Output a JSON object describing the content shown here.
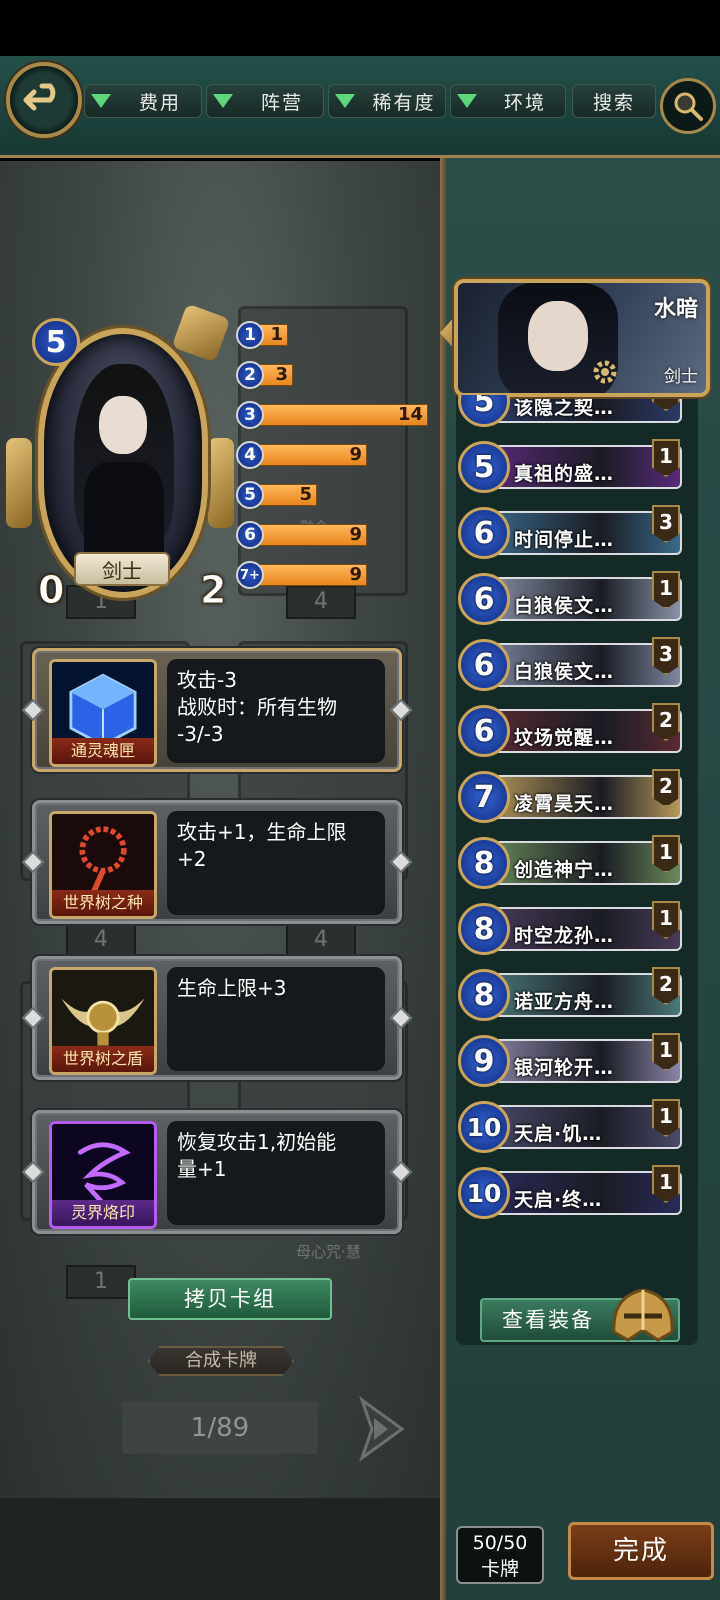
{
  "filters": [
    {
      "label": "费用"
    },
    {
      "label": "阵营"
    },
    {
      "label": "稀有度"
    },
    {
      "label": "环境"
    }
  ],
  "search_label": "搜索",
  "hero": {
    "cost": "5",
    "name": "剑士",
    "attack": "0",
    "health": "2"
  },
  "background": {
    "slot_counts": [
      "1",
      "4",
      "4",
      "4",
      "1"
    ],
    "ghost_text": [
      "融合",
      "母心咒·慧"
    ]
  },
  "histogram": [
    {
      "cost": "1",
      "count": "1",
      "value": 1
    },
    {
      "cost": "2",
      "count": "3",
      "value": 3
    },
    {
      "cost": "3",
      "count": "14",
      "value": 14
    },
    {
      "cost": "4",
      "count": "9",
      "value": 9
    },
    {
      "cost": "5",
      "count": "5",
      "value": 5
    },
    {
      "cost": "6",
      "count": "9",
      "value": 9
    },
    {
      "cost": "7+",
      "count": "9",
      "value": 9
    }
  ],
  "equipment": [
    {
      "icon": "crystal-cube-icon",
      "label": "通灵魂匣",
      "desc": "攻击-3\n战败时：所有生物\n-3/-3",
      "selected": true
    },
    {
      "icon": "prayer-beads-icon",
      "label": "世界树之种",
      "desc": "攻击+1，生命上限\n+2",
      "selected": false
    },
    {
      "icon": "winged-shield-icon",
      "label": "世界树之盾",
      "desc": "生命上限+3",
      "selected": false
    },
    {
      "icon": "rune-sigil-icon",
      "label": "灵界烙印",
      "desc": "恢复攻击1,初始能\n量+1",
      "selected": false
    }
  ],
  "copy_deck_label": "拷贝卡组",
  "craft_label": "合成卡牌",
  "page_indicator": "1/89",
  "leader": {
    "name": "水暗",
    "class": "剑士"
  },
  "cards": [
    {
      "cost": "5",
      "name": "该隐之契…",
      "count": "1",
      "bg": "#2b3a66"
    },
    {
      "cost": "5",
      "name": "真祖的盛…",
      "count": "1",
      "bg": "#5a2a7a"
    },
    {
      "cost": "6",
      "name": "时间停止…",
      "count": "3",
      "bg": "#3a6a8a"
    },
    {
      "cost": "6",
      "name": "白狼侯文…",
      "count": "1",
      "bg": "#8a93a8"
    },
    {
      "cost": "6",
      "name": "白狼侯文…",
      "count": "3",
      "bg": "#7d87a0"
    },
    {
      "cost": "6",
      "name": "坟场觉醒…",
      "count": "2",
      "bg": "#5a2a33"
    },
    {
      "cost": "7",
      "name": "凌霄昊天…",
      "count": "2",
      "bg": "#b89a5a"
    },
    {
      "cost": "8",
      "name": "创造神宁…",
      "count": "1",
      "bg": "#6a8a5a"
    },
    {
      "cost": "8",
      "name": "时空龙孙…",
      "count": "1",
      "bg": "#4a3a5a"
    },
    {
      "cost": "8",
      "name": "诺亚方舟…",
      "count": "2",
      "bg": "#4a7a7a"
    },
    {
      "cost": "9",
      "name": "银河轮开…",
      "count": "1",
      "bg": "#8a86a8"
    },
    {
      "cost": "10",
      "name": "天启·饥…",
      "count": "1",
      "bg": "#4a4a6a"
    },
    {
      "cost": "10",
      "name": "天启·终…",
      "count": "1",
      "bg": "#2a2a5a"
    }
  ],
  "view_equipment_label": "查看装备",
  "deck_count": {
    "value": "50/50",
    "unit": "卡牌"
  },
  "done_label": "完成"
}
